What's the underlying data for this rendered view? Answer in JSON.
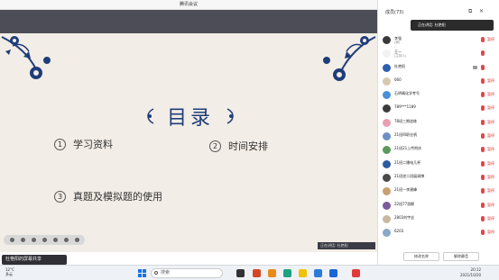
{
  "window": {
    "title": "腾讯会议"
  },
  "slide": {
    "title": "目录",
    "items": [
      {
        "num": "1",
        "label": "学习资料"
      },
      {
        "num": "2",
        "label": "时间安排"
      },
      {
        "num": "3",
        "label": "真题及模拟题的使用"
      }
    ]
  },
  "stage": {
    "speaker_tag": "正在讲话: 杜艳阳",
    "sharing_label": "杜艳阳的屏幕共享"
  },
  "panel": {
    "count_label": "成员(73)",
    "speaking_label": "正在讲话: 杜艳阳",
    "participants": [
      {
        "name": "李强",
        "sub": "(我)",
        "avatar": "#3a3a3a",
        "status": "暂停"
      },
      {
        "name": "王一",
        "sub": "(主持人)",
        "avatar": "#f2f2f2",
        "status": ""
      },
      {
        "name": "杜艳阳",
        "sub": "",
        "avatar": "#2d5fb0",
        "status": "",
        "video": true
      },
      {
        "name": "060",
        "sub": "",
        "avatar": "#d8c8b0",
        "status": "暂停"
      },
      {
        "name": "石明晴化学考号",
        "sub": "",
        "avatar": "#4a90d9",
        "status": "暂停"
      },
      {
        "name": "789***1189",
        "sub": "",
        "avatar": "#3c3c3c",
        "status": "暂停"
      },
      {
        "name": "78班三期追练",
        "sub": "",
        "avatar": "#e8a0b0",
        "status": "暂停"
      },
      {
        "name": "21班四职业帆",
        "sub": "",
        "avatar": "#6b8fc4",
        "status": "暂停"
      },
      {
        "name": "21班21上传附庆",
        "sub": "",
        "avatar": "#5a9a5a",
        "status": "暂停"
      },
      {
        "name": "21班二播电几杯",
        "sub": "",
        "avatar": "#2c5aa0",
        "status": "暂停"
      },
      {
        "name": "21班逆二班展调博",
        "sub": "",
        "avatar": "#4a4a4a",
        "status": "暂停"
      },
      {
        "name": "21班一李建峰",
        "sub": "",
        "avatar": "#c9a070",
        "status": "暂停"
      },
      {
        "name": "22班77游颢",
        "sub": "",
        "avatar": "#7a5a9a",
        "status": "暂停"
      },
      {
        "name": "2803刘宇丝",
        "sub": "",
        "avatar": "#c8b8a0",
        "status": "暂停"
      },
      {
        "name": "6203",
        "sub": "",
        "avatar": "#8aa8c8",
        "status": "暂停"
      }
    ],
    "rename_button": "修改名称",
    "unmute_button": "解除静音"
  },
  "taskbar": {
    "weather_temp": "12°C",
    "weather_desc": "多云",
    "search_placeholder": "搜索",
    "time": "20:12",
    "date": "2021/10/20"
  },
  "colors": {
    "slide_bg": "#f2ede6",
    "title_blue": "#1f3d7a",
    "stage_bg": "#4c4d56",
    "status_red": "#d33333"
  }
}
